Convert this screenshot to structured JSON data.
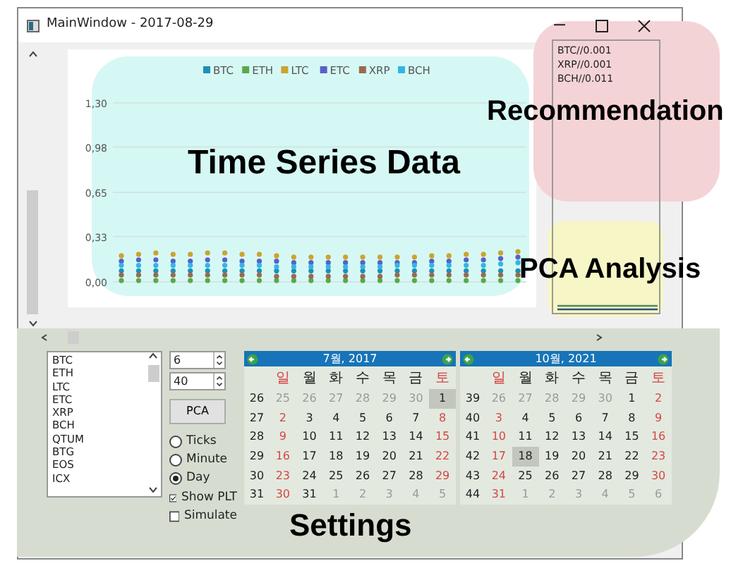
{
  "window": {
    "title": "MainWindow - 2017-08-29"
  },
  "chart": {
    "chart_data": {
      "type": "scatter",
      "grid": true,
      "legend": true,
      "yticks": [
        {
          "value": 0,
          "label": "0,00"
        },
        {
          "value": 0.33,
          "label": "0,33"
        },
        {
          "value": 0.65,
          "label": "0,65"
        },
        {
          "value": 0.98,
          "label": "0,98"
        },
        {
          "value": 1.3,
          "label": "1,30"
        }
      ],
      "ylim": [
        0,
        1.3
      ],
      "series": [
        {
          "name": "BTC",
          "color": "#1f8fb8",
          "values": [
            0.08,
            0.08,
            0.08,
            0.08,
            0.08,
            0.08,
            0.08,
            0.08,
            0.08,
            0.08,
            0.08,
            0.08,
            0.08,
            0.08,
            0.08,
            0.08,
            0.08,
            0.08,
            0.08,
            0.08,
            0.08,
            0.08,
            0.08,
            0.08
          ]
        },
        {
          "name": "ETH",
          "color": "#5aa84a",
          "values": [
            0.01,
            0.01,
            0.01,
            0.01,
            0.01,
            0.01,
            0.01,
            0.01,
            0.01,
            0.01,
            0.01,
            0.01,
            0.01,
            0.01,
            0.01,
            0.01,
            0.01,
            0.01,
            0.01,
            0.01,
            0.01,
            0.01,
            0.01,
            0.01
          ]
        },
        {
          "name": "LTC",
          "color": "#c9a52c",
          "values": [
            0.19,
            0.2,
            0.21,
            0.2,
            0.2,
            0.21,
            0.21,
            0.2,
            0.2,
            0.19,
            0.18,
            0.18,
            0.18,
            0.18,
            0.18,
            0.18,
            0.18,
            0.18,
            0.19,
            0.19,
            0.2,
            0.2,
            0.21,
            0.22
          ]
        },
        {
          "name": "ETC",
          "color": "#5b5fc7",
          "values": [
            0.15,
            0.16,
            0.16,
            0.15,
            0.15,
            0.16,
            0.16,
            0.15,
            0.15,
            0.15,
            0.14,
            0.14,
            0.14,
            0.14,
            0.14,
            0.14,
            0.14,
            0.14,
            0.15,
            0.15,
            0.16,
            0.16,
            0.17,
            0.18
          ]
        },
        {
          "name": "XRP",
          "color": "#9a6a4a",
          "values": [
            0.05,
            0.05,
            0.05,
            0.05,
            0.05,
            0.05,
            0.05,
            0.05,
            0.05,
            0.04,
            0.04,
            0.04,
            0.04,
            0.04,
            0.04,
            0.04,
            0.05,
            0.05,
            0.05,
            0.05,
            0.05,
            0.05,
            0.05,
            0.05
          ]
        },
        {
          "name": "BCH",
          "color": "#2fb7e6",
          "values": [
            0.12,
            0.12,
            0.12,
            0.12,
            0.12,
            0.12,
            0.12,
            0.12,
            0.12,
            0.11,
            0.11,
            0.11,
            0.11,
            0.11,
            0.11,
            0.11,
            0.12,
            0.12,
            0.12,
            0.12,
            0.12,
            0.12,
            0.13,
            0.14
          ]
        }
      ]
    }
  },
  "recommendations": [
    "BTC//0.001",
    "XRP//0.001",
    "BCH//0.011"
  ],
  "annotations": [
    {
      "kind": "chart",
      "label": "Time Series Data",
      "color": "#d6f8f5"
    },
    {
      "kind": "recommend",
      "label": "Recommendation",
      "color": "#f4d3d7"
    },
    {
      "kind": "pca",
      "label": "PCA Analysis",
      "color": "#f7f6c6"
    },
    {
      "kind": "settings",
      "label": "Settings",
      "color": "#d6ddd0"
    }
  ],
  "settings": {
    "coins": [
      {
        "name": "BTC",
        "selected": false
      },
      {
        "name": "ETH",
        "selected": false
      },
      {
        "name": "LTC",
        "selected": false
      },
      {
        "name": "ETC",
        "selected": false
      },
      {
        "name": "XRP",
        "selected": false
      },
      {
        "name": "BCH",
        "selected": false
      },
      {
        "name": "QTUM",
        "selected": false
      },
      {
        "name": "BTG",
        "selected": false
      },
      {
        "name": "EOS",
        "selected": false
      },
      {
        "name": "ICX",
        "selected": false
      }
    ],
    "spin_1": "6",
    "spin_2": "40",
    "pca_button": "PCA",
    "intervals": [
      {
        "label": "Ticks",
        "selected": false
      },
      {
        "label": "Minute",
        "selected": false
      },
      {
        "label": "Day",
        "selected": true
      }
    ],
    "options": [
      {
        "label": "Show PLT",
        "checked": true
      },
      {
        "label": "Simulate",
        "checked": false
      }
    ]
  },
  "calendars": [
    {
      "month": "7월, 2017",
      "weekdays": [
        "일",
        "월",
        "화",
        "수",
        "목",
        "금",
        "토"
      ],
      "weeks": [
        {
          "week": "26",
          "days": [
            {
              "day": "25",
              "other_month": true,
              "selected": false
            },
            {
              "day": "26",
              "other_month": true,
              "selected": false
            },
            {
              "day": "27",
              "other_month": true,
              "selected": false
            },
            {
              "day": "28",
              "other_month": true,
              "selected": false
            },
            {
              "day": "29",
              "other_month": true,
              "selected": false
            },
            {
              "day": "30",
              "other_month": true,
              "selected": false
            },
            {
              "day": "1",
              "other_month": false,
              "selected": true
            }
          ]
        },
        {
          "week": "27",
          "days": [
            {
              "day": "2",
              "other_month": false,
              "selected": false
            },
            {
              "day": "3",
              "other_month": false,
              "selected": false
            },
            {
              "day": "4",
              "other_month": false,
              "selected": false
            },
            {
              "day": "5",
              "other_month": false,
              "selected": false
            },
            {
              "day": "6",
              "other_month": false,
              "selected": false
            },
            {
              "day": "7",
              "other_month": false,
              "selected": false
            },
            {
              "day": "8",
              "other_month": false,
              "selected": false
            }
          ]
        },
        {
          "week": "28",
          "days": [
            {
              "day": "9",
              "other_month": false,
              "selected": false
            },
            {
              "day": "10",
              "other_month": false,
              "selected": false
            },
            {
              "day": "11",
              "other_month": false,
              "selected": false
            },
            {
              "day": "12",
              "other_month": false,
              "selected": false
            },
            {
              "day": "13",
              "other_month": false,
              "selected": false
            },
            {
              "day": "14",
              "other_month": false,
              "selected": false
            },
            {
              "day": "15",
              "other_month": false,
              "selected": false
            }
          ]
        },
        {
          "week": "29",
          "days": [
            {
              "day": "16",
              "other_month": false,
              "selected": false
            },
            {
              "day": "17",
              "other_month": false,
              "selected": false
            },
            {
              "day": "18",
              "other_month": false,
              "selected": false
            },
            {
              "day": "19",
              "other_month": false,
              "selected": false
            },
            {
              "day": "20",
              "other_month": false,
              "selected": false
            },
            {
              "day": "21",
              "other_month": false,
              "selected": false
            },
            {
              "day": "22",
              "other_month": false,
              "selected": false
            }
          ]
        },
        {
          "week": "30",
          "days": [
            {
              "day": "23",
              "other_month": false,
              "selected": false
            },
            {
              "day": "24",
              "other_month": false,
              "selected": false
            },
            {
              "day": "25",
              "other_month": false,
              "selected": false
            },
            {
              "day": "26",
              "other_month": false,
              "selected": false
            },
            {
              "day": "27",
              "other_month": false,
              "selected": false
            },
            {
              "day": "28",
              "other_month": false,
              "selected": false
            },
            {
              "day": "29",
              "other_month": false,
              "selected": false
            }
          ]
        },
        {
          "week": "31",
          "days": [
            {
              "day": "30",
              "other_month": false,
              "selected": false
            },
            {
              "day": "31",
              "other_month": false,
              "selected": false
            },
            {
              "day": "1",
              "other_month": true,
              "selected": false
            },
            {
              "day": "2",
              "other_month": true,
              "selected": false
            },
            {
              "day": "3",
              "other_month": true,
              "selected": false
            },
            {
              "day": "4",
              "other_month": true,
              "selected": false
            },
            {
              "day": "5",
              "other_month": true,
              "selected": false
            }
          ]
        }
      ]
    },
    {
      "month": "10월, 2021",
      "weekdays": [
        "일",
        "월",
        "화",
        "수",
        "목",
        "금",
        "토"
      ],
      "weeks": [
        {
          "week": "39",
          "days": [
            {
              "day": "26",
              "other_month": true,
              "selected": false
            },
            {
              "day": "27",
              "other_month": true,
              "selected": false
            },
            {
              "day": "28",
              "other_month": true,
              "selected": false
            },
            {
              "day": "29",
              "other_month": true,
              "selected": false
            },
            {
              "day": "30",
              "other_month": true,
              "selected": false
            },
            {
              "day": "1",
              "other_month": false,
              "selected": false
            },
            {
              "day": "2",
              "other_month": false,
              "selected": false
            }
          ]
        },
        {
          "week": "40",
          "days": [
            {
              "day": "3",
              "other_month": false,
              "selected": false
            },
            {
              "day": "4",
              "other_month": false,
              "selected": false
            },
            {
              "day": "5",
              "other_month": false,
              "selected": false
            },
            {
              "day": "6",
              "other_month": false,
              "selected": false
            },
            {
              "day": "7",
              "other_month": false,
              "selected": false
            },
            {
              "day": "8",
              "other_month": false,
              "selected": false
            },
            {
              "day": "9",
              "other_month": false,
              "selected": false
            }
          ]
        },
        {
          "week": "41",
          "days": [
            {
              "day": "10",
              "other_month": false,
              "selected": false
            },
            {
              "day": "11",
              "other_month": false,
              "selected": false
            },
            {
              "day": "12",
              "other_month": false,
              "selected": false
            },
            {
              "day": "13",
              "other_month": false,
              "selected": false
            },
            {
              "day": "14",
              "other_month": false,
              "selected": false
            },
            {
              "day": "15",
              "other_month": false,
              "selected": false
            },
            {
              "day": "16",
              "other_month": false,
              "selected": false
            }
          ]
        },
        {
          "week": "42",
          "days": [
            {
              "day": "17",
              "other_month": false,
              "selected": false
            },
            {
              "day": "18",
              "other_month": false,
              "selected": true
            },
            {
              "day": "19",
              "other_month": false,
              "selected": false
            },
            {
              "day": "20",
              "other_month": false,
              "selected": false
            },
            {
              "day": "21",
              "other_month": false,
              "selected": false
            },
            {
              "day": "22",
              "other_month": false,
              "selected": false
            },
            {
              "day": "23",
              "other_month": false,
              "selected": false
            }
          ]
        },
        {
          "week": "43",
          "days": [
            {
              "day": "24",
              "other_month": false,
              "selected": false
            },
            {
              "day": "25",
              "other_month": false,
              "selected": false
            },
            {
              "day": "26",
              "other_month": false,
              "selected": false
            },
            {
              "day": "27",
              "other_month": false,
              "selected": false
            },
            {
              "day": "28",
              "other_month": false,
              "selected": false
            },
            {
              "day": "29",
              "other_month": false,
              "selected": false
            },
            {
              "day": "30",
              "other_month": false,
              "selected": false
            }
          ]
        },
        {
          "week": "44",
          "days": [
            {
              "day": "31",
              "other_month": false,
              "selected": false
            },
            {
              "day": "1",
              "other_month": true,
              "selected": false
            },
            {
              "day": "2",
              "other_month": true,
              "selected": false
            },
            {
              "day": "3",
              "other_month": true,
              "selected": false
            },
            {
              "day": "4",
              "other_month": true,
              "selected": false
            },
            {
              "day": "5",
              "other_month": true,
              "selected": false
            },
            {
              "day": "6",
              "other_month": true,
              "selected": false
            }
          ]
        }
      ]
    }
  ]
}
